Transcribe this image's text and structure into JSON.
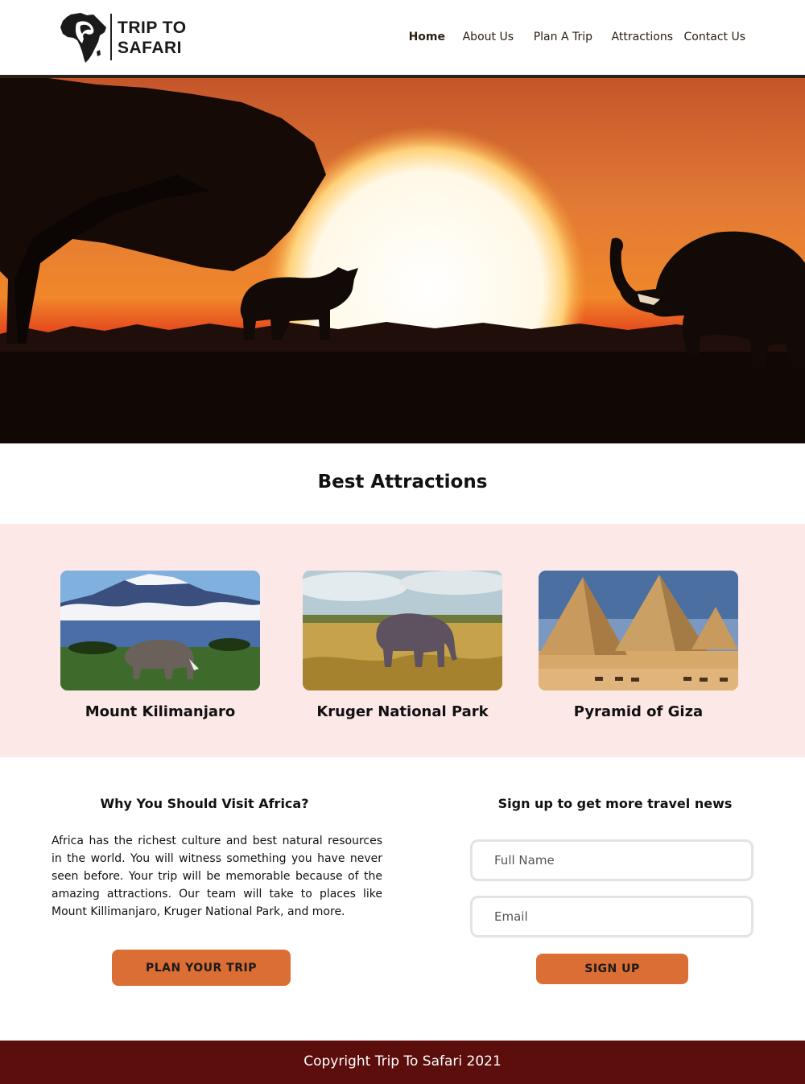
{
  "brand": {
    "name_line1": "TRIP TO",
    "name_line2": "SAFARI",
    "logo_icon": "africa-map-woman-profile-icon"
  },
  "nav": {
    "items": [
      {
        "label": "Home",
        "active": true
      },
      {
        "label": "About Us"
      },
      {
        "label": "Plan A Trip"
      },
      {
        "label": "Attractions"
      },
      {
        "label": "Contact Us"
      }
    ]
  },
  "hero": {
    "image": "sunset savanna with acacia tree, rhino and elephant silhouettes"
  },
  "attractions": {
    "title": "Best Attractions",
    "items": [
      {
        "name": "Mount Kilimanjaro"
      },
      {
        "name": "Kruger National Park"
      },
      {
        "name": "Pyramid of Giza"
      }
    ]
  },
  "why": {
    "title": "Why You Should Visit Africa?",
    "body": "Africa has the richest culture and best natural resources in the world. You will witness something you have never seen before. Your trip will be memorable because of the amazing attractions. Our team will take to places like Mount Killimanjaro, Kruger National Park, and more.",
    "button": "PLAN YOUR TRIP"
  },
  "signup": {
    "title": "Sign up to get more travel news",
    "name_placeholder": "Full Name",
    "email_placeholder": "Email",
    "button": "SIGN UP"
  },
  "footer": {
    "text": "Copyright Trip To Safari 2021"
  },
  "colors": {
    "accent": "#db6e34",
    "footer_bg": "#5b0e0c",
    "attractions_bg": "#fde8e8",
    "header_rule": "#2b2116"
  }
}
